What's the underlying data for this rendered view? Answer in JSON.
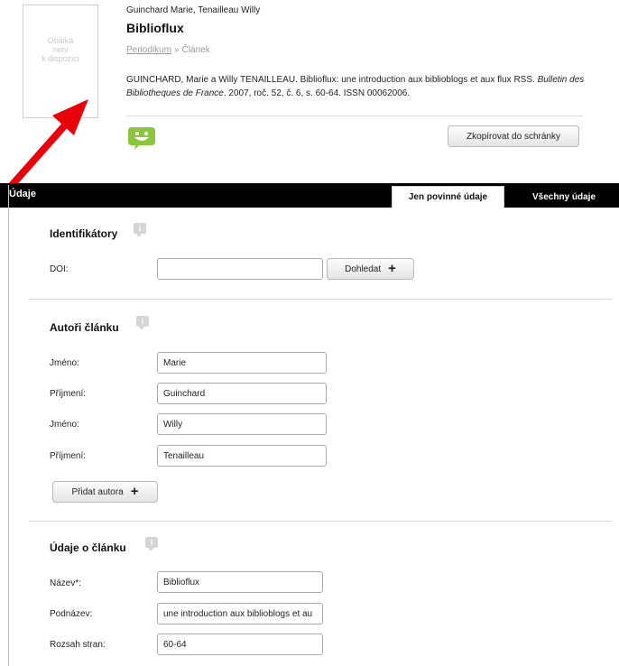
{
  "cover": {
    "placeholder_text": "Obálka\nnení\nk dispozici"
  },
  "record": {
    "authors": "Guinchard Marie, Tenailleau Willy",
    "title": "Biblioflux",
    "breadcrumb": {
      "parent": "Periodikum",
      "separator": "»",
      "current": "Článek"
    },
    "citation": {
      "main": "GUINCHARD, Marie a Willy TENAILLEAU. Biblioflux: une introduction aux biblioblogs et aux flux RSS.",
      "journal": "Bulletin des Bibliotheques de France",
      "rest": ". 2007, roč. 52, č. 6, s. 60-64. ISSN 00062006."
    },
    "copy_button_label": "Zkopírovat do schránky"
  },
  "section_bar": {
    "label": "Údaje",
    "tabs": [
      {
        "label": "Jen povinné údaje",
        "active": true
      },
      {
        "label": "Všechny údaje",
        "active": false
      }
    ]
  },
  "identifiers": {
    "heading": "Identifikátory",
    "doi_label": "DOI:",
    "doi_value": "",
    "lookup_button": "Dohledat"
  },
  "authors_section": {
    "heading": "Autoři článku",
    "fields": [
      {
        "label": "Jméno:",
        "value": "Marie"
      },
      {
        "label": "Příjmení:",
        "value": "Guinchard"
      },
      {
        "label": "Jméno:",
        "value": "Willy"
      },
      {
        "label": "Příjmení:",
        "value": "Tenailleau"
      }
    ],
    "add_author_button": "Přidat autora"
  },
  "article_section": {
    "heading": "Údaje o článku",
    "fields": [
      {
        "label": "Název*:",
        "value": "Biblioflux"
      },
      {
        "label": "Podnázev:",
        "value": "une introduction aux biblioblogs et au"
      },
      {
        "label": "Rozsah stran:",
        "value": "60-64"
      }
    ]
  },
  "colors": {
    "section_bar": "#000000",
    "arrow": "#e8000b",
    "smiley": "#8cc63f",
    "info_icon": "#d5d5d5"
  },
  "icons": [
    "smiley-icon",
    "info-icon",
    "plus-icon",
    "red-arrow-annotation"
  ]
}
